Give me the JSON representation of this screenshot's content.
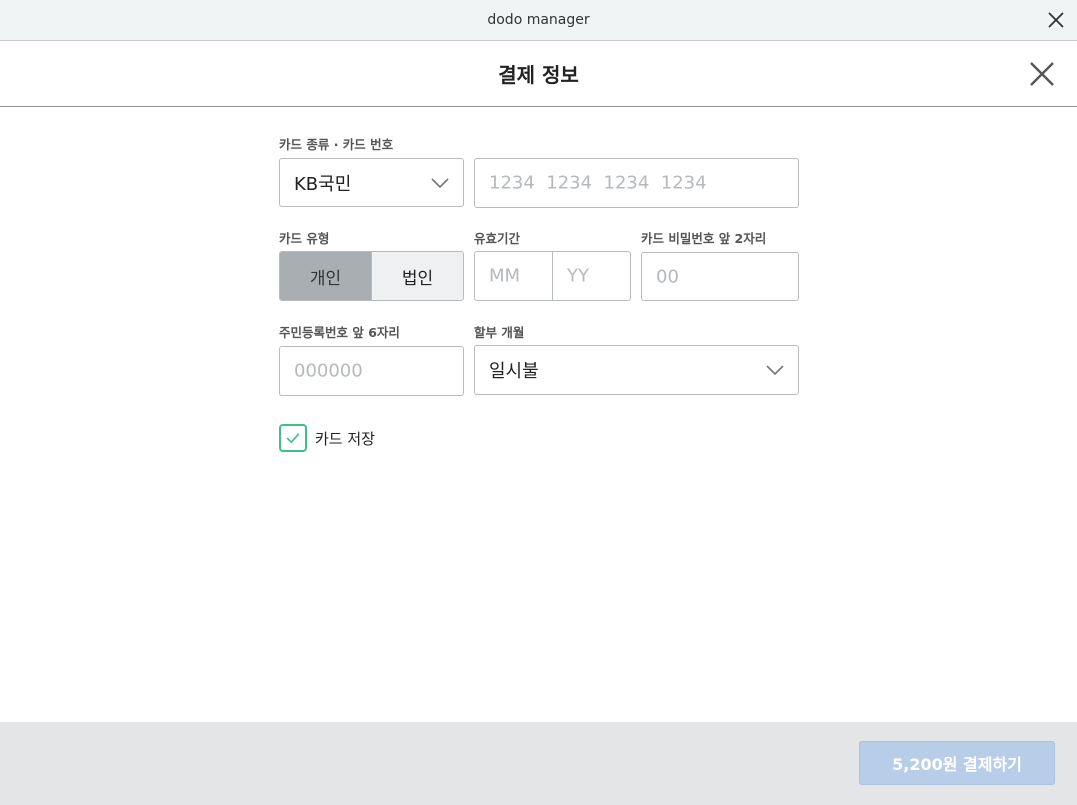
{
  "window": {
    "title": "dodo manager"
  },
  "modal": {
    "title": "결제 정보"
  },
  "form": {
    "card_company_number_label": "카드 종류 · 카드 번호",
    "card_company_value": "KB국민",
    "card_number_placeholder": "1234  1234  1234  1234",
    "card_type_label": "카드 유형",
    "card_type_options": [
      "개인",
      "법인"
    ],
    "card_type_selected": "개인",
    "expiry_label": "유효기간",
    "expiry_month_placeholder": "MM",
    "expiry_year_placeholder": "YY",
    "password_label": "카드 비밀번호 앞 2자리",
    "password_placeholder": "00",
    "resident_label": "주민등록번호 앞 6자리",
    "resident_placeholder": "000000",
    "installment_label": "할부 개월",
    "installment_value": "일시불",
    "save_card_label": "카드 저장",
    "save_card_checked": true
  },
  "footer": {
    "pay_button_label": "5,200원 결제하기"
  },
  "colors": {
    "accent_green": "#3fc089",
    "pay_button_bg": "#b8cde8"
  },
  "icons": {
    "window_close": "close-icon",
    "modal_close": "close-icon",
    "dropdown": "chevron-down-icon",
    "check": "check-icon"
  }
}
